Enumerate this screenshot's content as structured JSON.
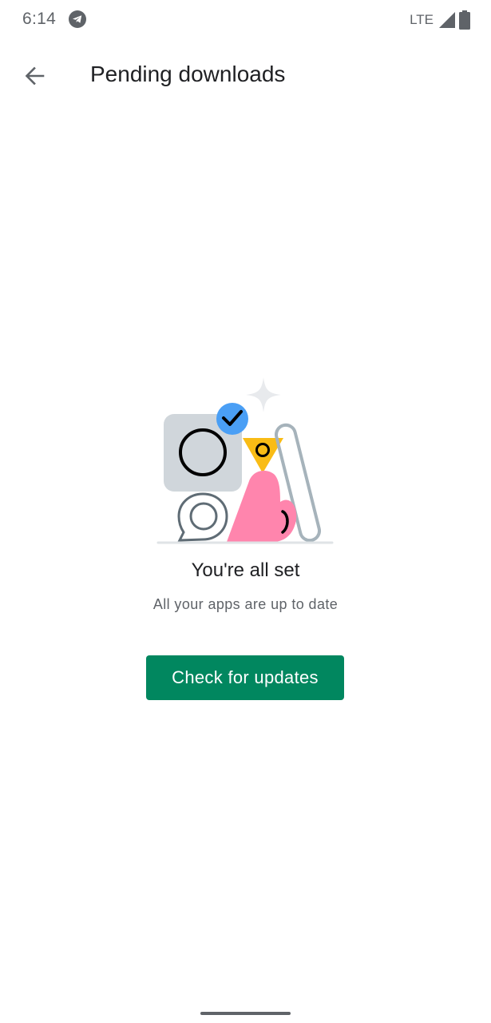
{
  "status_bar": {
    "time": "6:14",
    "network": "LTE",
    "icons": [
      "telegram-icon",
      "signal-icon",
      "battery-icon"
    ]
  },
  "app_bar": {
    "back_icon": "arrow-back-icon",
    "title": "Pending downloads"
  },
  "empty_state": {
    "title": "You're all set",
    "subtitle": "All your apps are up to date",
    "button_label": "Check for updates"
  },
  "colors": {
    "accent": "#01875f",
    "illustration_gray": "#d0d6db",
    "illustration_blue": "#4a9ff5",
    "illustration_yellow": "#f9bc15",
    "illustration_pink": "#ff85ad"
  }
}
